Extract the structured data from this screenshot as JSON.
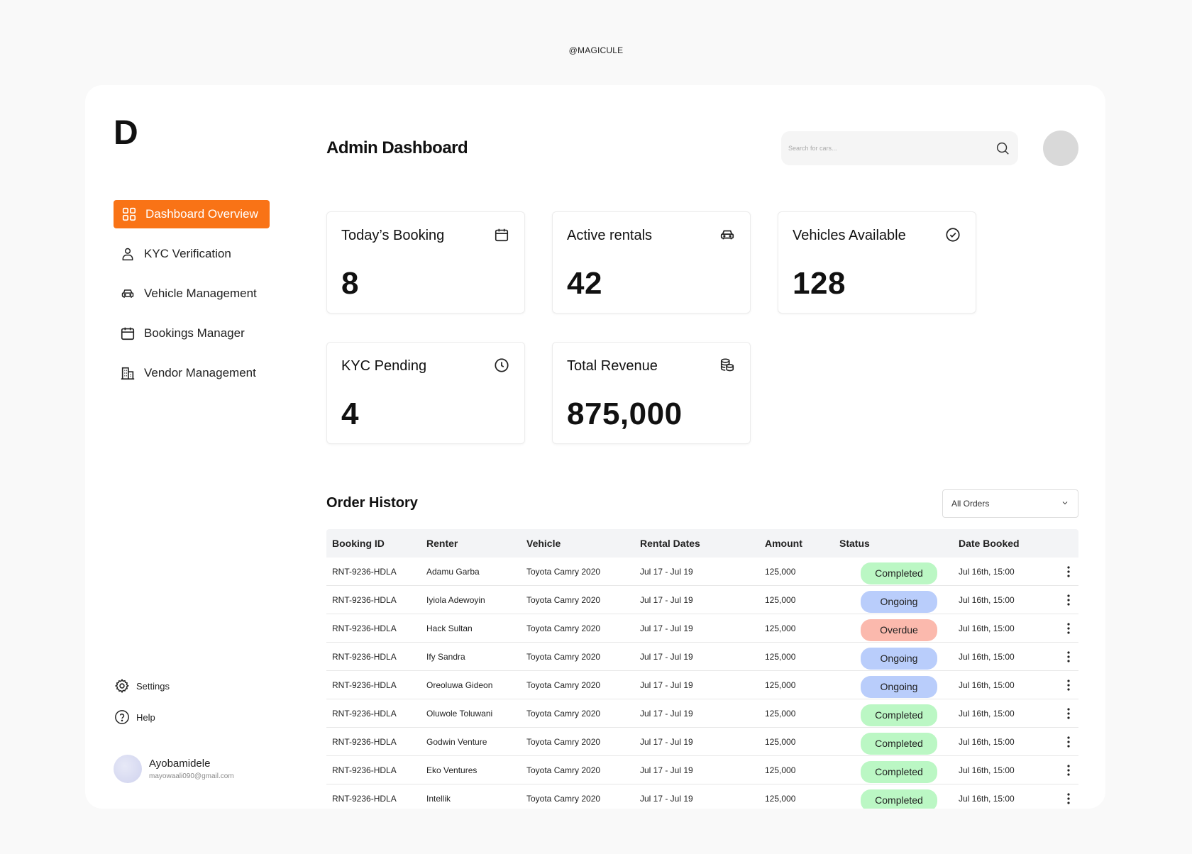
{
  "watermark": "@MAGICULE",
  "brand": {
    "logo": "D"
  },
  "nav": {
    "items": [
      {
        "label": "Dashboard Overview",
        "icon": "grid-icon",
        "active": true
      },
      {
        "label": "KYC Verification",
        "icon": "user-icon"
      },
      {
        "label": "Vehicle Management",
        "icon": "car-icon"
      },
      {
        "label": "Bookings Manager",
        "icon": "calendar-icon"
      },
      {
        "label": "Vendor Management",
        "icon": "building-icon"
      }
    ],
    "active_color": "#f97316"
  },
  "bottom_nav": {
    "settings": "Settings",
    "help": "Help"
  },
  "user": {
    "name": "Ayobamidele",
    "email": "mayowaali090@gmail.com"
  },
  "header": {
    "title": "Admin Dashboard",
    "search_placeholder": "Search for cars..."
  },
  "stats": {
    "todays_booking": {
      "label": "Today’s Booking",
      "value": "8",
      "icon": "calendar-icon"
    },
    "active_rentals": {
      "label": "Active rentals",
      "value": "42",
      "icon": "car-icon"
    },
    "vehicles_available": {
      "label": "Vehicles Available",
      "value": "128",
      "icon": "check-circle-icon"
    },
    "kyc_pending": {
      "label": "KYC Pending",
      "value": "4",
      "icon": "clock-icon"
    },
    "total_revenue": {
      "label": "Total Revenue",
      "value": "875,000",
      "icon": "coins-icon"
    }
  },
  "orders": {
    "title": "Order History",
    "filter": "All Orders",
    "columns": [
      "Booking ID",
      "Renter",
      "Vehicle",
      "Rental Dates",
      "Amount",
      "Status",
      "Date Booked"
    ],
    "status_colors": {
      "Completed": "#bbf7c4",
      "Ongoing": "#b9cdfb",
      "Overdue": "#fbb9ad"
    },
    "rows": [
      {
        "id": "RNT-9236-HDLA",
        "renter": "Adamu Garba",
        "vehicle": "Toyota Camry 2020",
        "dates": "Jul 17 - Jul 19",
        "amount": "125,000",
        "status": "Completed",
        "booked": "Jul 16th, 15:00"
      },
      {
        "id": "RNT-9236-HDLA",
        "renter": "Iyiola Adewoyin",
        "vehicle": "Toyota Camry 2020",
        "dates": "Jul 17 - Jul 19",
        "amount": "125,000",
        "status": "Ongoing",
        "booked": "Jul 16th, 15:00"
      },
      {
        "id": "RNT-9236-HDLA",
        "renter": "Hack Sultan",
        "vehicle": "Toyota Camry 2020",
        "dates": "Jul 17 - Jul 19",
        "amount": "125,000",
        "status": "Overdue",
        "booked": "Jul 16th, 15:00"
      },
      {
        "id": "RNT-9236-HDLA",
        "renter": "Ify Sandra",
        "vehicle": "Toyota Camry 2020",
        "dates": "Jul 17 - Jul 19",
        "amount": "125,000",
        "status": "Ongoing",
        "booked": "Jul 16th, 15:00"
      },
      {
        "id": "RNT-9236-HDLA",
        "renter": "Oreoluwa Gideon",
        "vehicle": "Toyota Camry 2020",
        "dates": "Jul 17 - Jul 19",
        "amount": "125,000",
        "status": "Ongoing",
        "booked": "Jul 16th, 15:00"
      },
      {
        "id": "RNT-9236-HDLA",
        "renter": "Oluwole Toluwani",
        "vehicle": "Toyota Camry 2020",
        "dates": "Jul 17 - Jul 19",
        "amount": "125,000",
        "status": "Completed",
        "booked": "Jul 16th, 15:00"
      },
      {
        "id": "RNT-9236-HDLA",
        "renter": "Godwin Venture",
        "vehicle": "Toyota Camry 2020",
        "dates": "Jul 17 - Jul 19",
        "amount": "125,000",
        "status": "Completed",
        "booked": "Jul 16th, 15:00"
      },
      {
        "id": "RNT-9236-HDLA",
        "renter": "Eko Ventures",
        "vehicle": "Toyota Camry 2020",
        "dates": "Jul 17 - Jul 19",
        "amount": "125,000",
        "status": "Completed",
        "booked": "Jul 16th, 15:00"
      },
      {
        "id": "RNT-9236-HDLA",
        "renter": "Intellik",
        "vehicle": "Toyota Camry 2020",
        "dates": "Jul 17 - Jul 19",
        "amount": "125,000",
        "status": "Completed",
        "booked": "Jul 16th, 15:00"
      }
    ]
  }
}
